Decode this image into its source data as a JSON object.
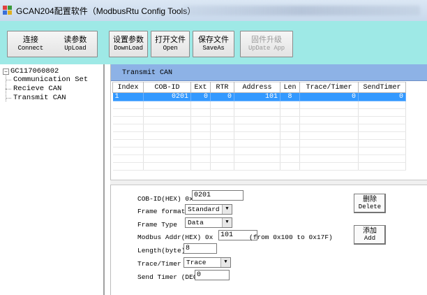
{
  "window": {
    "title": "GCAN204配置软件（ModbusRtu Config Tools）"
  },
  "toolbar": {
    "buttons": [
      {
        "zh": "连接",
        "en": "Connect"
      },
      {
        "zh": "读参数",
        "en": "UpLoad"
      },
      {
        "zh": "设置参数",
        "en": "DownLoad"
      },
      {
        "zh": "打开文件",
        "en": "Open"
      },
      {
        "zh": "保存文件",
        "en": "SaveAs"
      },
      {
        "zh": "固件升级",
        "en": "UpDate App",
        "disabled": true
      }
    ],
    "background": "#9ee9e6"
  },
  "tree": {
    "root": "GC117060802",
    "expander": "⊟",
    "children": [
      "Communication Set",
      "Recieve CAN",
      "Transmit CAN"
    ]
  },
  "table": {
    "caption": "Transmit CAN",
    "columns": [
      "Index",
      "COB-ID",
      "Ext",
      "RTR",
      "Address",
      "Len",
      "Trace/Timer",
      "SendTimer"
    ],
    "rows": [
      [
        "1",
        "0201",
        "0",
        "0",
        "101",
        "8",
        "0",
        "0"
      ]
    ],
    "selected_row_color": "#3399ff",
    "caption_color": "#8db2e6"
  },
  "form": {
    "cobid_label": "COB-ID(HEX)  0x",
    "cobid_value": "0201",
    "frame_format_label": "Frame format",
    "frame_format_value": "Standard",
    "frame_type_label": "Frame Type",
    "frame_type_value": "Data",
    "modbus_addr_label": "Modbus Addr(HEX)  0x",
    "modbus_addr_value": "101",
    "modbus_addr_hint": "(from 0x100 to 0x17F)",
    "length_label": "Length(byte)",
    "length_value": "8",
    "trace_label": "Trace/Timer",
    "trace_value": "Trace",
    "send_timer_label": "Send Timer (DEC)",
    "send_timer_value": "0",
    "delete_zh": "删除",
    "delete_en": "Delete",
    "add_zh": "添加",
    "add_en": "Add"
  }
}
